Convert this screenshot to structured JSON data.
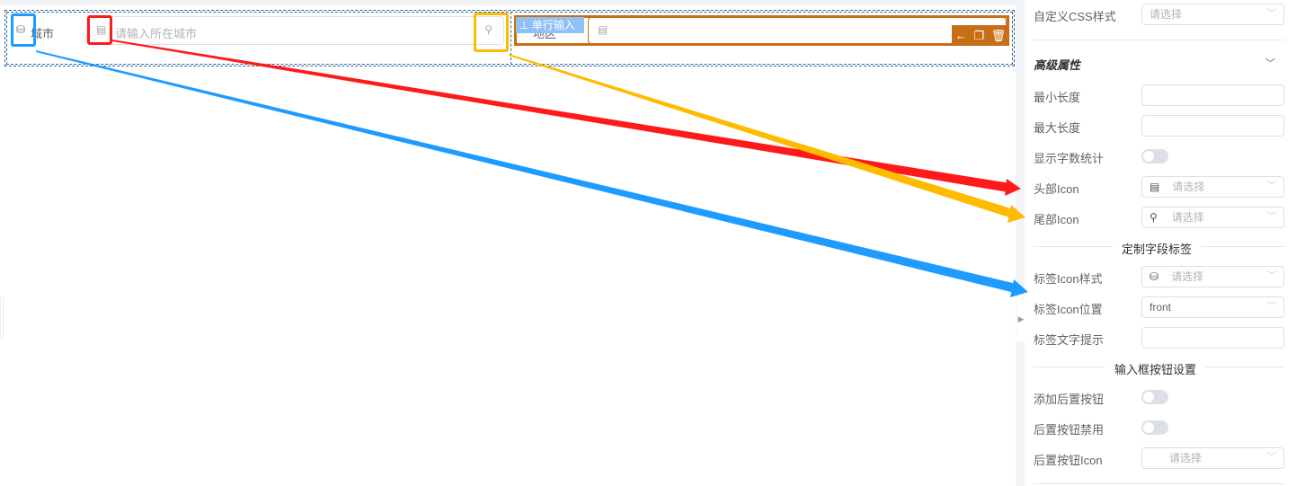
{
  "canvas": {
    "field1": {
      "label": "城市",
      "placeholder": "请输入所在城市",
      "prefix_icon": "building-icon",
      "suffix_icon": "location-icon",
      "label_icon": "database-icon"
    },
    "field2": {
      "label": "地区",
      "tag": "单行输入",
      "prefix_icon": "building-icon",
      "label_icon": "database-icon"
    },
    "toolbar": {
      "icons": [
        "arrow-left-icon",
        "copy-icon",
        "delete-icon"
      ]
    }
  },
  "annotation_colors": {
    "blue": "#1e9bff",
    "red": "#ff1a1a",
    "yellow": "#ffbb00",
    "selected": "#c76f17"
  },
  "panel": {
    "custom_css": {
      "label": "自定义CSS样式",
      "placeholder": "请选择"
    },
    "advanced_header": "高级属性",
    "min_length": {
      "label": "最小长度"
    },
    "max_length": {
      "label": "最大长度"
    },
    "show_word_count": {
      "label": "显示字数统计",
      "on": false
    },
    "prefix_icon": {
      "label": "头部Icon",
      "placeholder": "请选择"
    },
    "suffix_icon": {
      "label": "尾部Icon",
      "placeholder": "请选择"
    },
    "section_label": "定制字段标签",
    "label_icon_style": {
      "label": "标签Icon样式",
      "placeholder": "请选择"
    },
    "label_icon_position": {
      "label": "标签Icon位置",
      "value": "front"
    },
    "label_tooltip": {
      "label": "标签文字提示"
    },
    "section_button": "输入框按钮设置",
    "add_append_button": {
      "label": "添加后置按钮",
      "on": false
    },
    "append_button_disabled": {
      "label": "后置按钮禁用",
      "on": false
    },
    "append_button_icon": {
      "label": "后置按钮Icon",
      "placeholder": "请选择"
    }
  }
}
